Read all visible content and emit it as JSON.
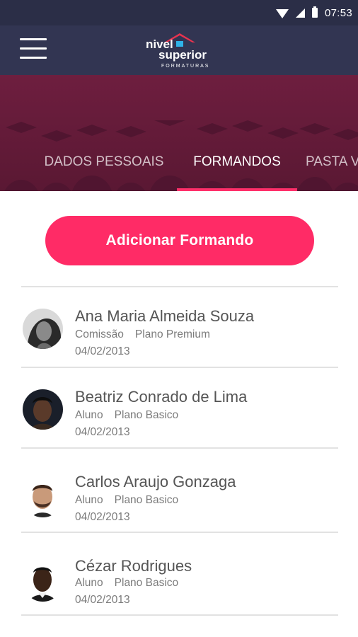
{
  "status_bar": {
    "time": "07:53"
  },
  "app_bar": {
    "logo": {
      "line1": "nivel",
      "line2": "superior",
      "tagline": "FORMATURAS"
    }
  },
  "tabs": [
    {
      "label": "DADOS PESSOAIS",
      "active": false
    },
    {
      "label": "FORMANDOS",
      "active": true
    },
    {
      "label": "PASTA V",
      "active": false
    }
  ],
  "add_button": {
    "label": "Adicionar Formando"
  },
  "students": [
    {
      "name": "Ana Maria Almeida Souza",
      "role": "Comissão",
      "plan": "Plano Premium",
      "date": "04/02/2013"
    },
    {
      "name": "Beatriz Conrado de Lima",
      "role": "Aluno",
      "plan": "Plano Basico",
      "date": "04/02/2013"
    },
    {
      "name": "Carlos Araujo Gonzaga",
      "role": "Aluno",
      "plan": "Plano Basico",
      "date": "04/02/2013"
    },
    {
      "name": "Cézar Rodrigues",
      "role": "Aluno",
      "plan": "Plano Basico",
      "date": "04/02/2013"
    }
  ],
  "colors": {
    "status_bar": "#2b2e47",
    "app_bar": "#323552",
    "banner": "#6e1e3f",
    "accent": "#ff2b66"
  },
  "icons": [
    "menu-icon",
    "wifi-icon",
    "signal-icon",
    "battery-icon"
  ]
}
